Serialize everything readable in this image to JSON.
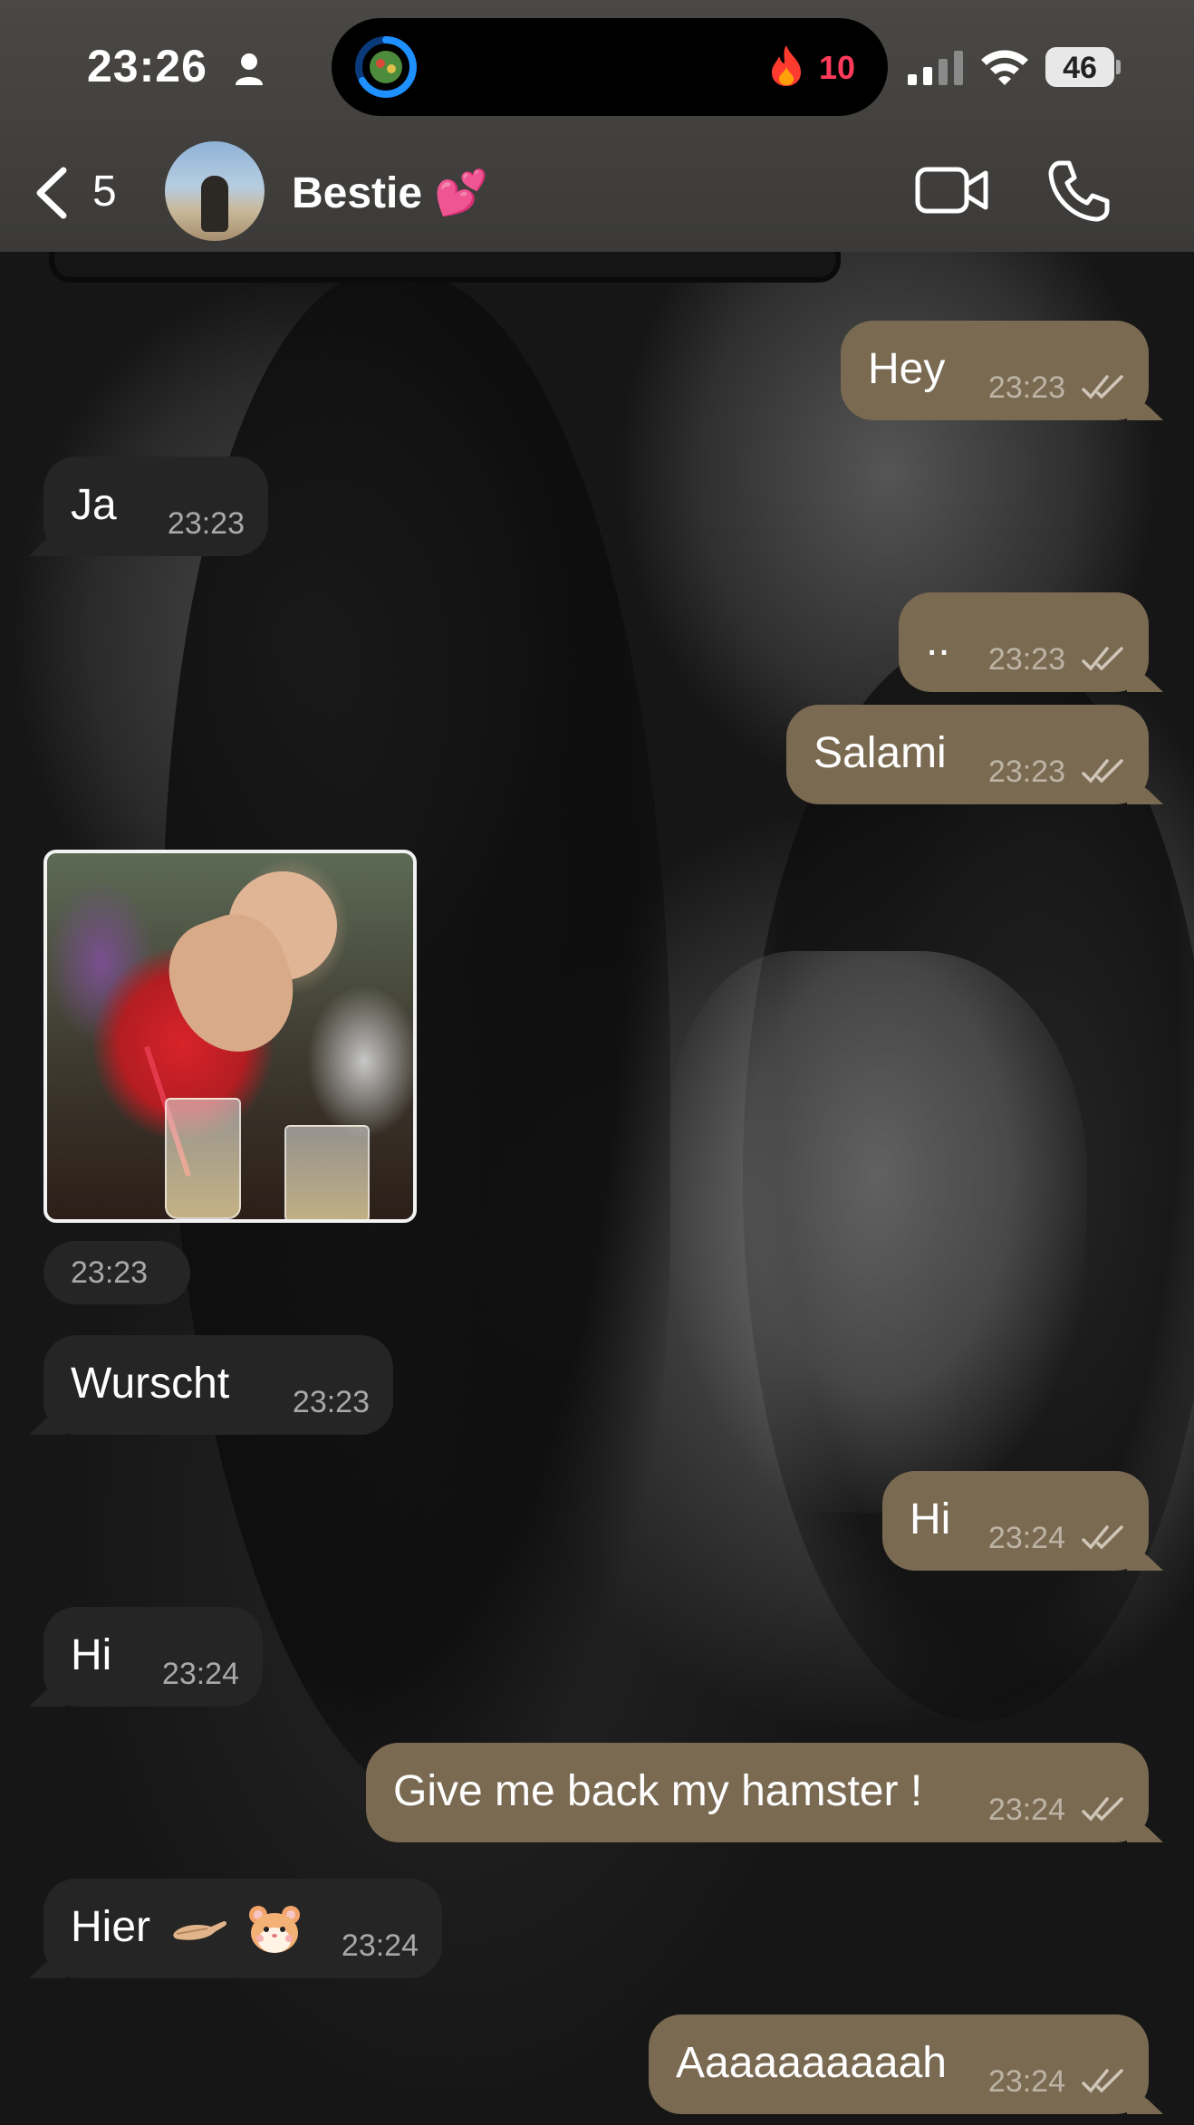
{
  "status": {
    "time": "23:26",
    "streak_count": "10",
    "battery": "46"
  },
  "header": {
    "back_count": "5",
    "contact_name": "Bestie 💕"
  },
  "messages": [
    {
      "dir": "out",
      "text": "Hey",
      "time": "23:23"
    },
    {
      "dir": "in",
      "text": "Ja",
      "time": "23:23"
    },
    {
      "dir": "out",
      "text": "..",
      "time": "23:23"
    },
    {
      "dir": "out",
      "text": "Salami",
      "time": "23:23"
    },
    {
      "dir": "in",
      "type": "photo",
      "time": "23:23"
    },
    {
      "dir": "in",
      "text": "Wurscht",
      "time": "23:23"
    },
    {
      "dir": "out",
      "text": "Hi",
      "time": "23:24"
    },
    {
      "dir": "in",
      "text": "Hi",
      "time": "23:24"
    },
    {
      "dir": "out",
      "text": "Give me back my hamster !",
      "time": "23:24"
    },
    {
      "dir": "in",
      "text": "Hier",
      "emoji": [
        "palm-up-hand-emoji",
        "hamster-emoji"
      ],
      "time": "23:24"
    },
    {
      "dir": "out",
      "text": "Aaaaaaaaaah",
      "time": "23:24"
    }
  ],
  "colors": {
    "outgoing_bubble": "#7a6a52",
    "incoming_bubble": "#252525",
    "streak": "#ff3b5c"
  }
}
